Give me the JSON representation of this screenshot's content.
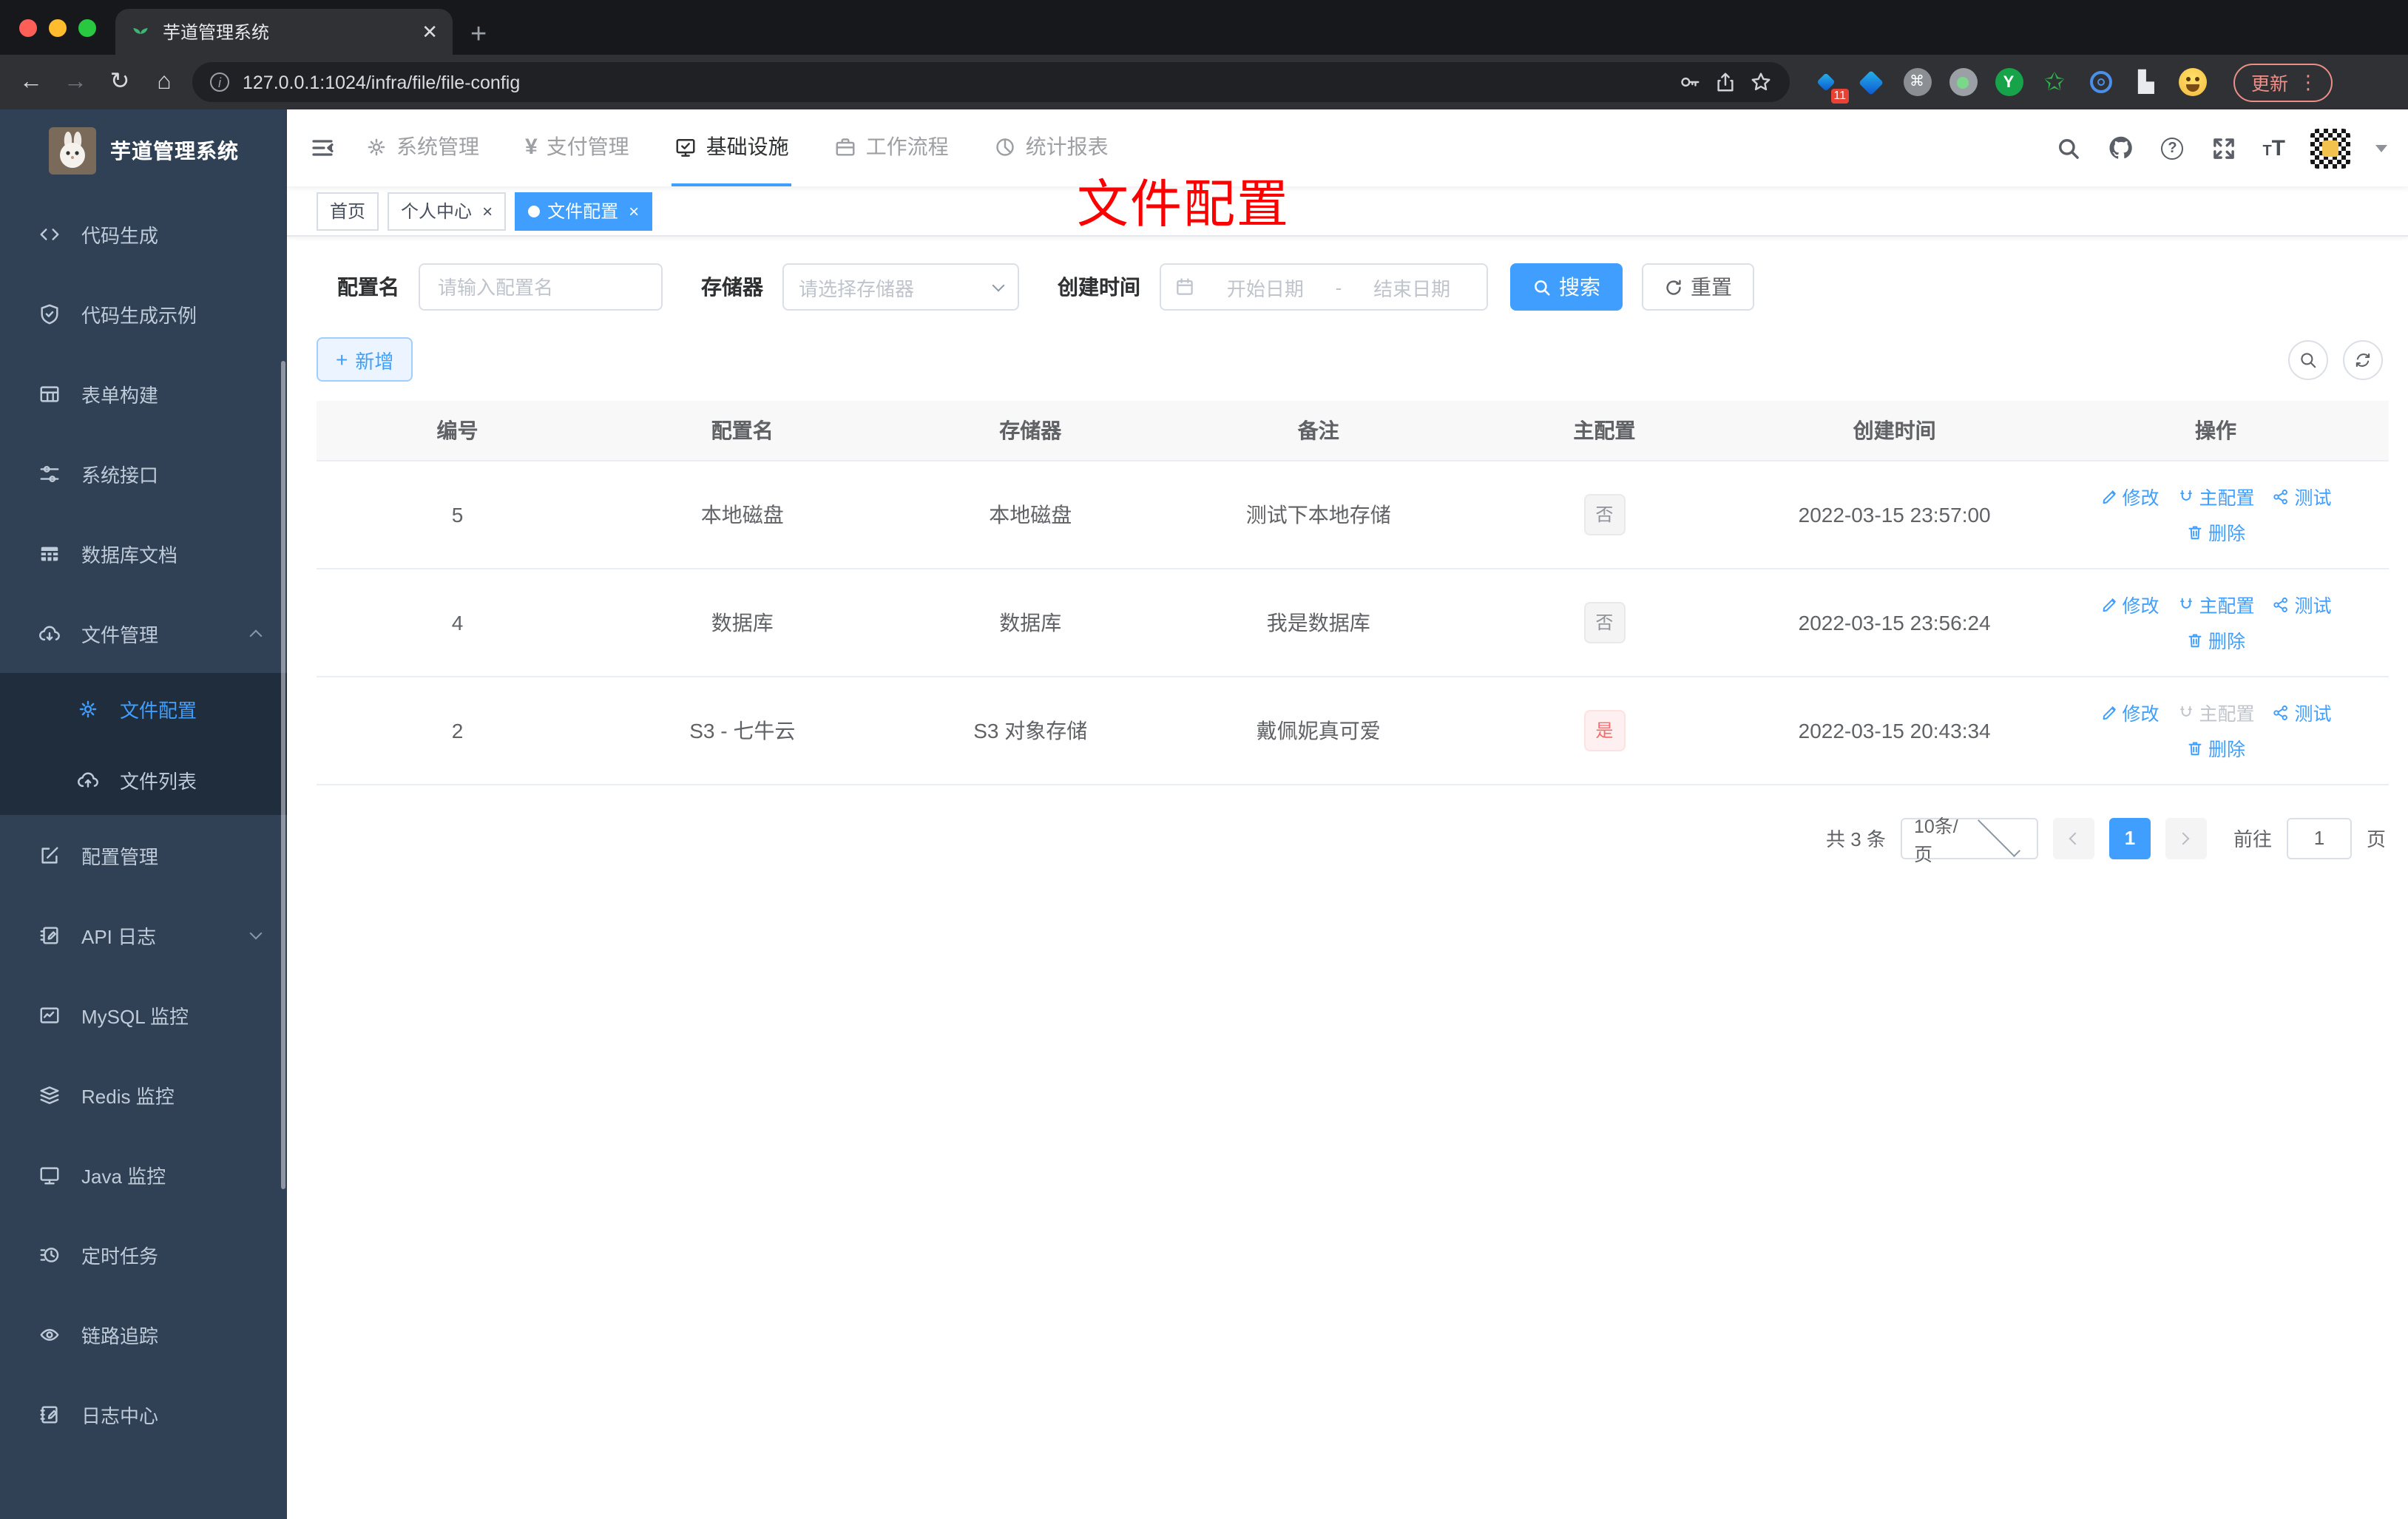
{
  "browser": {
    "tab_title": "芋道管理系统",
    "url": "127.0.0.1:1024/infra/file/file-config",
    "update_label": "更新",
    "extension_badge": "11"
  },
  "sidebar": {
    "title": "芋道管理系统",
    "items": [
      {
        "label": "代码生成"
      },
      {
        "label": "代码生成示例"
      },
      {
        "label": "表单构建"
      },
      {
        "label": "系统接口"
      },
      {
        "label": "数据库文档"
      },
      {
        "label": "文件管理"
      },
      {
        "label": "配置管理"
      },
      {
        "label": "API 日志"
      },
      {
        "label": "MySQL 监控"
      },
      {
        "label": "Redis 监控"
      },
      {
        "label": "Java 监控"
      },
      {
        "label": "定时任务"
      },
      {
        "label": "链路追踪"
      },
      {
        "label": "日志中心"
      }
    ],
    "file_submenu": [
      {
        "label": "文件配置"
      },
      {
        "label": "文件列表"
      }
    ]
  },
  "navbar": {
    "menus": [
      "系统管理",
      "支付管理",
      "基础设施",
      "工作流程",
      "统计报表"
    ]
  },
  "tags": [
    "首页",
    "个人中心",
    "文件配置"
  ],
  "annotation": "文件配置",
  "filter": {
    "name_label": "配置名",
    "name_placeholder": "请输入配置名",
    "storage_label": "存储器",
    "storage_placeholder": "请选择存储器",
    "date_label": "创建时间",
    "date_start_placeholder": "开始日期",
    "date_separator": "-",
    "date_end_placeholder": "结束日期",
    "search_label": "搜索",
    "reset_label": "重置"
  },
  "toolbar": {
    "add_label": "新增"
  },
  "table": {
    "headers": [
      "编号",
      "配置名",
      "存储器",
      "备注",
      "主配置",
      "创建时间",
      "操作"
    ],
    "actions": {
      "edit": "修改",
      "master": "主配置",
      "test": "测试",
      "delete": "删除"
    },
    "rows": [
      {
        "id": "5",
        "name": "本地磁盘",
        "storage": "本地磁盘",
        "remark": "测试下本地存储",
        "master": "否",
        "created": "2022-03-15 23:57:00"
      },
      {
        "id": "4",
        "name": "数据库",
        "storage": "数据库",
        "remark": "我是数据库",
        "master": "否",
        "created": "2022-03-15 23:56:24"
      },
      {
        "id": "2",
        "name": "S3 - 七牛云",
        "storage": "S3 对象存储",
        "remark": "戴佩妮真可爱",
        "master": "是",
        "created": "2022-03-15 20:43:34"
      }
    ]
  },
  "pagination": {
    "total": "共 3 条",
    "page_size": "10条/页",
    "current_page": "1",
    "goto_label": "前往",
    "goto_value": "1",
    "page_label": "页"
  },
  "colors": {
    "accent": "#409eff",
    "danger_tag": "#f56c6c",
    "info_tag": "#909399",
    "annotation": "#fb0000",
    "sidebar_bg": "#304156"
  }
}
